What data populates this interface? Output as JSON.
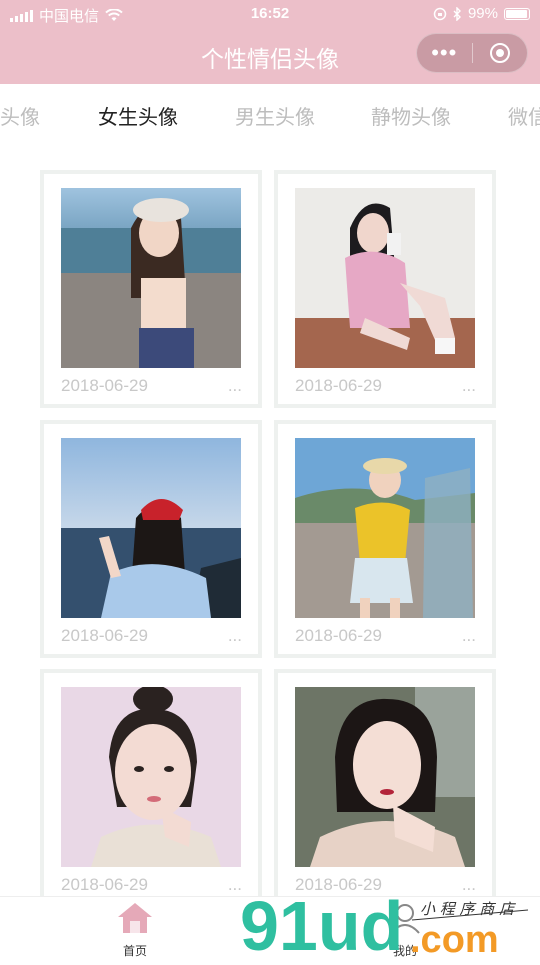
{
  "status_bar": {
    "carrier": "中国电信",
    "time": "16:52",
    "battery": "99%"
  },
  "nav": {
    "title": "个性情侣头像"
  },
  "tabs": [
    {
      "label": "头像"
    },
    {
      "label": "女生头像",
      "active": true
    },
    {
      "label": "男生头像"
    },
    {
      "label": "静物头像"
    },
    {
      "label": "微信"
    }
  ],
  "cards": [
    {
      "date": "2018-06-29",
      "more": "...",
      "photo": "girl-beach-cap"
    },
    {
      "date": "2018-06-29",
      "more": "...",
      "photo": "girl-pink-sitting"
    },
    {
      "date": "2018-06-29",
      "more": "...",
      "photo": "girl-sea-red-cap"
    },
    {
      "date": "2018-06-29",
      "more": "...",
      "photo": "girl-yellow-shirt"
    },
    {
      "date": "2018-06-29",
      "more": "...",
      "photo": "girl-bun-portrait"
    },
    {
      "date": "2018-06-29",
      "more": "...",
      "photo": "girl-dark-hair"
    }
  ],
  "tabbar": {
    "home": "首页",
    "mine": "我的"
  },
  "watermark": {
    "brand_main": "91ud",
    "brand_suffix": ".com",
    "tagline": "小程序商店"
  },
  "colors": {
    "header_pink": "#ecbfc9",
    "card_border": "#eef1ef",
    "active_tab": "#222222",
    "inactive_tab": "#bdbdbd"
  }
}
